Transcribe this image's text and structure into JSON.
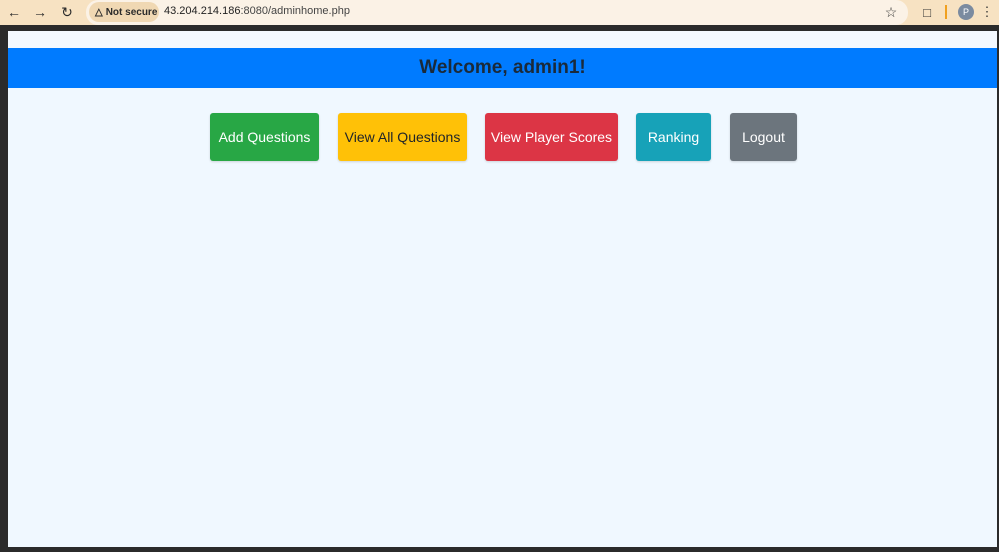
{
  "browser": {
    "security_label": "Not secure",
    "url_host": "43.204.214.186",
    "url_rest": ":8080/adminhome.php",
    "profile_initial": "P"
  },
  "page": {
    "welcome": "Welcome, admin1!"
  },
  "buttons": [
    {
      "label": "Add Questions",
      "color": "#28a745"
    },
    {
      "label": "View All Questions",
      "color": "#ffc107"
    },
    {
      "label": "View Player Scores",
      "color": "#dc3545"
    },
    {
      "label": "Ranking",
      "color": "#17a2b8"
    },
    {
      "label": "Logout",
      "color": "#6c757d"
    }
  ]
}
